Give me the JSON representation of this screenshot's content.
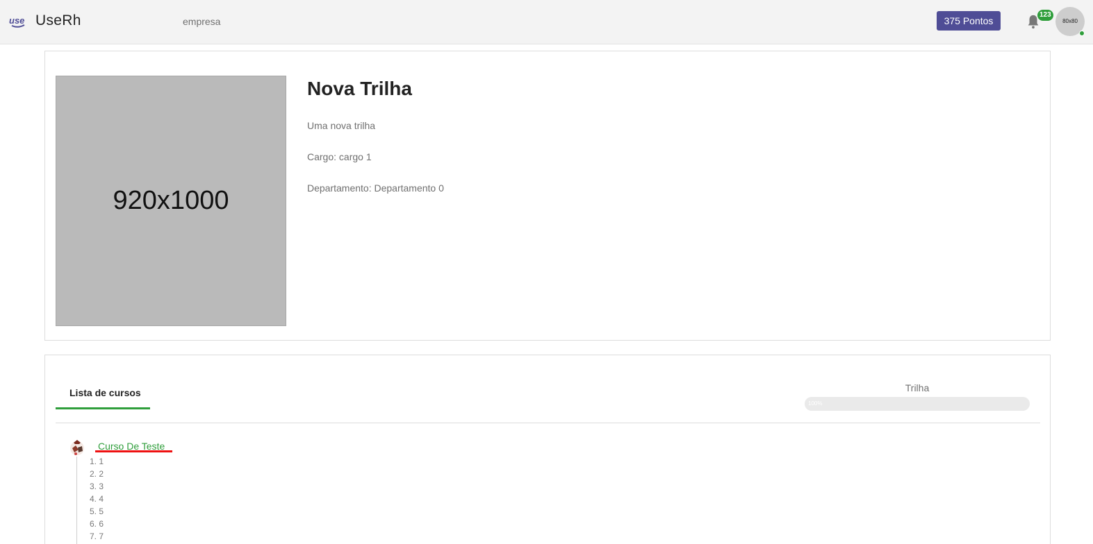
{
  "header": {
    "logo_mark": "use",
    "app_name": "UseRh",
    "company": "empresa",
    "points": "375 Pontos",
    "notifications_count": "123",
    "avatar_text": "80x80",
    "status_color": "#2f9e3b",
    "icons": [
      "bell-icon",
      "logo-mark"
    ]
  },
  "trail": {
    "image_placeholder": "920x1000",
    "title": "Nova Trilha",
    "description": "Uma nova trilha",
    "cargo": "Cargo: cargo 1",
    "departamento": "Departamento: Departamento 0"
  },
  "courses": {
    "tab_label": "Lista de cursos",
    "progress_label": "Trilha",
    "progress_text": "100%",
    "progress_value": 1.0,
    "course_title": "Curso De Teste",
    "course_icon": "course-thumbnail-icon",
    "items": [
      "1. 1",
      "2. 2",
      "3. 3",
      "4. 4",
      "5. 5",
      "6. 6",
      "7. 7"
    ]
  },
  "colors": {
    "brand": "#4f4d96",
    "accent": "#2f9e3b",
    "highlight": "#e11111"
  }
}
